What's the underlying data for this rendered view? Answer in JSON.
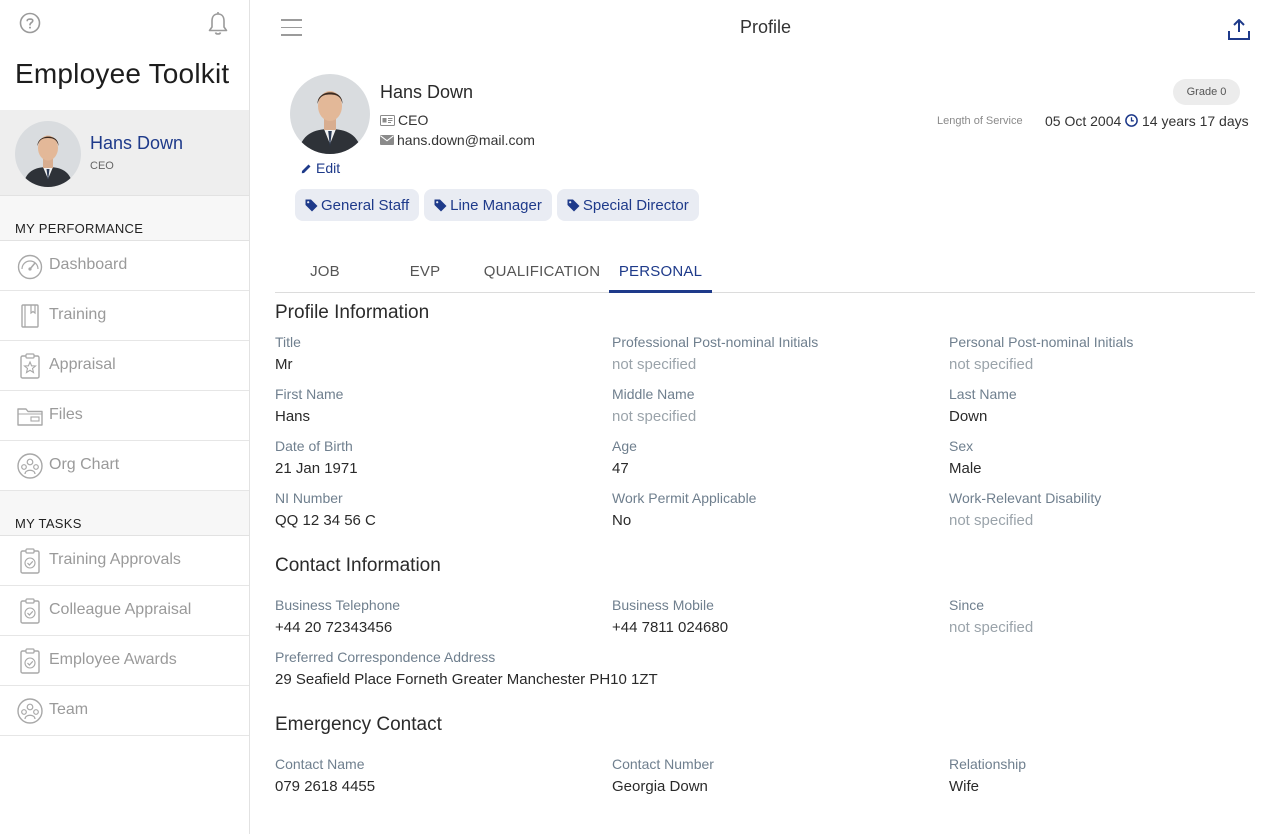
{
  "sidebar": {
    "app_title": "Employee Toolkit",
    "user": {
      "name": "Hans Down",
      "role": "CEO"
    },
    "performance_heading": "MY PERFORMANCE",
    "performance_items": [
      {
        "label": "Dashboard",
        "icon": "speedometer-icon"
      },
      {
        "label": "Training",
        "icon": "book-icon"
      },
      {
        "label": "Appraisal",
        "icon": "clipboard-star-icon"
      },
      {
        "label": "Files",
        "icon": "folder-icon"
      },
      {
        "label": "Org Chart",
        "icon": "people-circle-icon"
      }
    ],
    "tasks_heading": "MY TASKS",
    "task_items": [
      {
        "label": "Training Approvals",
        "icon": "clipboard-check-icon"
      },
      {
        "label": "Colleague Appraisal",
        "icon": "clipboard-check-icon"
      },
      {
        "label": "Employee Awards",
        "icon": "clipboard-check-icon"
      },
      {
        "label": "Team",
        "icon": "people-circle-icon"
      }
    ]
  },
  "header": {
    "title": "Profile"
  },
  "profile": {
    "name": "Hans Down",
    "role": "CEO",
    "email": "hans.down@mail.com",
    "edit_label": "Edit",
    "grade": "Grade 0",
    "length_of_service_label": "Length of Service",
    "start_date": "05 Oct 2004",
    "service_duration": "14 years 17 days",
    "tags": [
      "General Staff",
      "Line Manager",
      "Special Director"
    ]
  },
  "tabs": [
    {
      "label": "JOB",
      "active": false
    },
    {
      "label": "EVP",
      "active": false
    },
    {
      "label": "QUALIFICATION",
      "active": false
    },
    {
      "label": "PERSONAL",
      "active": true
    }
  ],
  "sections": {
    "profile_info": {
      "title": "Profile Information",
      "fields": [
        {
          "label": "Title",
          "value": "Mr"
        },
        {
          "label": "Professional Post-nominal Initials",
          "value": "not specified"
        },
        {
          "label": "Personal Post-nominal Initials",
          "value": "not specified"
        },
        {
          "label": "First Name",
          "value": "Hans"
        },
        {
          "label": "Middle Name",
          "value": "not specified"
        },
        {
          "label": "Last Name",
          "value": "Down"
        },
        {
          "label": "Date of Birth",
          "value": "21 Jan 1971"
        },
        {
          "label": "Age",
          "value": "47"
        },
        {
          "label": "Sex",
          "value": "Male"
        },
        {
          "label": "NI Number",
          "value": "QQ 12 34 56 C"
        },
        {
          "label": "Work Permit Applicable",
          "value": "No"
        },
        {
          "label": "Work-Relevant Disability",
          "value": "not specified"
        }
      ]
    },
    "contact_info": {
      "title": "Contact Information",
      "fields": [
        {
          "label": "Business Telephone",
          "value": "+44 20 72343456"
        },
        {
          "label": "Business Mobile",
          "value": "+44 7811 024680"
        },
        {
          "label": "Since",
          "value": "not specified"
        },
        {
          "label": "Preferred Correspondence Address",
          "value": "29 Seafield Place Forneth Greater Manchester PH10 1ZT"
        }
      ]
    },
    "emergency_contact": {
      "title": "Emergency Contact",
      "fields": [
        {
          "label": "Contact Name",
          "value": "079 2618 4455"
        },
        {
          "label": "Contact Number",
          "value": "Georgia Down"
        },
        {
          "label": "Relationship",
          "value": "Wife"
        }
      ]
    }
  },
  "colors": {
    "accent": "#1e3a8a",
    "muted_text": "#9aa3aa",
    "label_text": "#6f7f8e"
  }
}
